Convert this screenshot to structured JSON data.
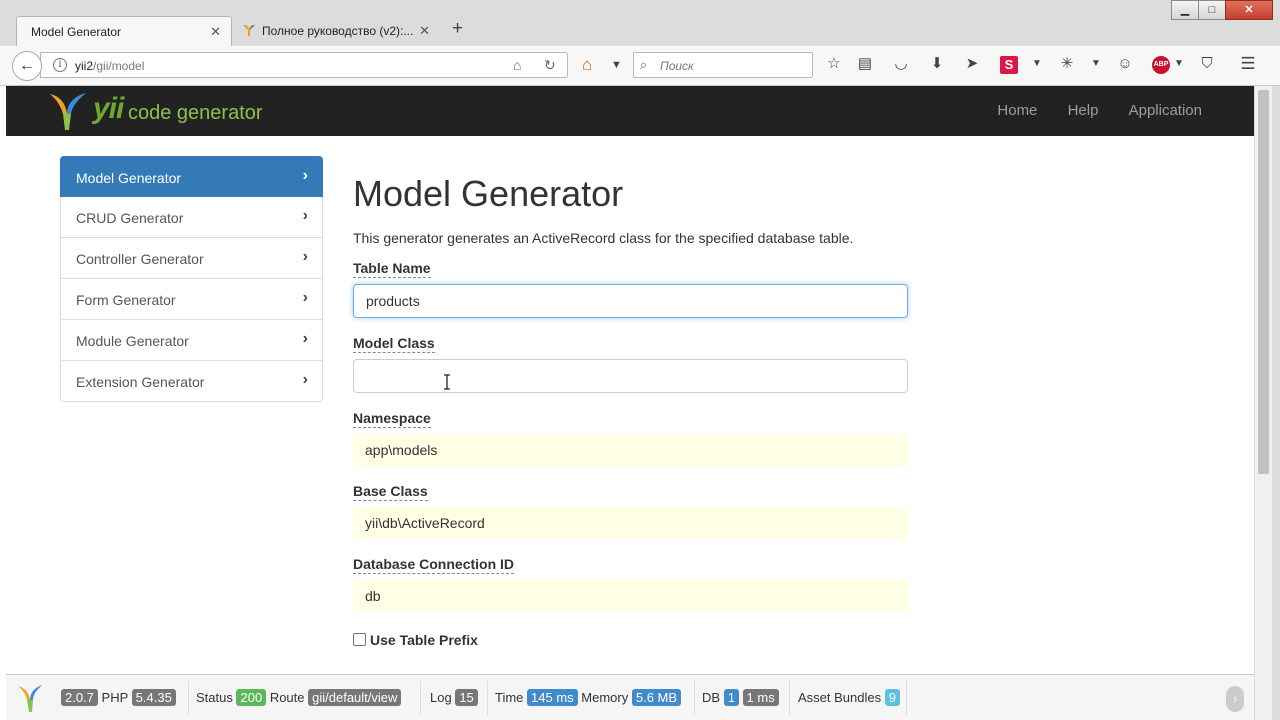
{
  "browser": {
    "tabs": [
      {
        "label": "Model Generator",
        "active": true
      },
      {
        "label": "Полное руководство (v2):...",
        "active": false
      }
    ],
    "url": {
      "host": "yii2",
      "path": "/gii/model"
    },
    "search_placeholder": "Поиск"
  },
  "header": {
    "logo_yii": "yii",
    "logo_text": "code generator",
    "nav": [
      "Home",
      "Help",
      "Application"
    ]
  },
  "sidebar": {
    "items": [
      {
        "label": "Model Generator",
        "active": true
      },
      {
        "label": "CRUD Generator"
      },
      {
        "label": "Controller Generator"
      },
      {
        "label": "Form Generator"
      },
      {
        "label": "Module Generator"
      },
      {
        "label": "Extension Generator"
      }
    ]
  },
  "main": {
    "title": "Model Generator",
    "description": "This generator generates an ActiveRecord class for the specified database table.",
    "fields": {
      "table_name": {
        "label": "Table Name",
        "value": "products"
      },
      "model_class": {
        "label": "Model Class",
        "value": ""
      },
      "namespace": {
        "label": "Namespace",
        "value": "app\\models"
      },
      "base_class": {
        "label": "Base Class",
        "value": "yii\\db\\ActiveRecord"
      },
      "db_connection": {
        "label": "Database Connection ID",
        "value": "db"
      },
      "use_table_prefix": {
        "label": "Use Table Prefix",
        "checked": false
      }
    }
  },
  "debug_toolbar": {
    "yii_version": "2.0.7",
    "php_label": "PHP",
    "php_version": "5.4.35",
    "status_label": "Status",
    "status_code": "200",
    "route_label": "Route",
    "route": "gii/default/view",
    "log_label": "Log",
    "log_count": "15",
    "time_label": "Time",
    "time": "145 ms",
    "memory_label": "Memory",
    "memory": "5.6 MB",
    "db_label": "DB",
    "db_queries": "1",
    "db_time": "1 ms",
    "asset_label": "Asset Bundles",
    "asset_count": "9"
  },
  "colors": {
    "active_blue": "#337ab7",
    "header_bg": "#222222",
    "sticky_bg": "#ffffe6",
    "logo_green": "#6ca832"
  }
}
